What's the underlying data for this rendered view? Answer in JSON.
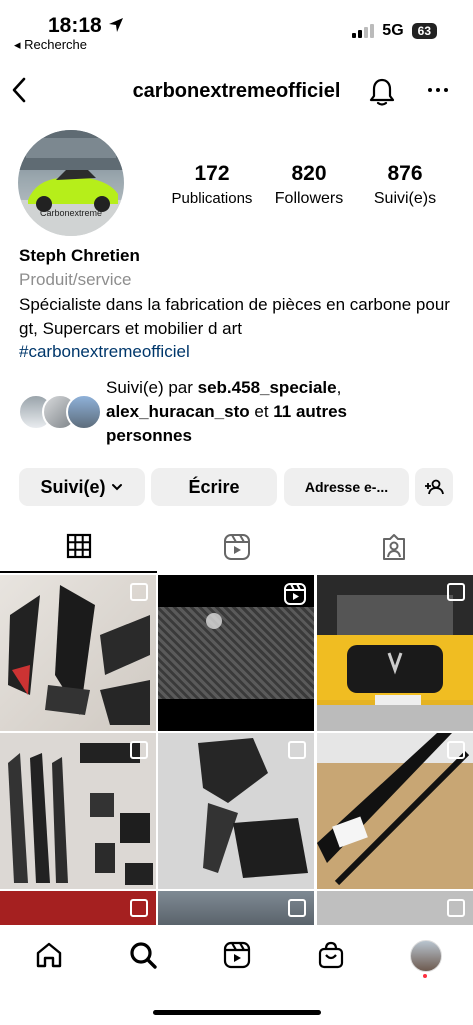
{
  "status_bar": {
    "time": "18:18",
    "back_label": "◂ Recherche",
    "network": "5G",
    "battery": "63"
  },
  "header": {
    "username": "carbonextremeofficiel"
  },
  "profile": {
    "avatar_text": "Carbonextreme",
    "stats": [
      {
        "value": "172",
        "label": "Publications"
      },
      {
        "value": "820",
        "label": "Followers"
      },
      {
        "value": "876",
        "label": "Suivi(e)s"
      }
    ],
    "name": "Steph Chretien",
    "category": "Produit/service",
    "bio": "Spécialiste dans la fabrication de  pièces en carbone pour gt, Supercars et mobilier d art",
    "hashtag": "#carbonextremeofficiel",
    "mutual": {
      "prefix": "Suivi(e) par ",
      "user1": "seb.458_speciale",
      "sep": ",",
      "user2": "alex_huracan_sto",
      "mid": " et ",
      "others": "11 autres personnes"
    }
  },
  "actions": {
    "following": "Suivi(e)",
    "message": "Écrire",
    "email": "Adresse e-..."
  },
  "colors": {
    "link": "#00376b",
    "button_bg": "#efefef",
    "notification_dot": "#ff3040"
  }
}
